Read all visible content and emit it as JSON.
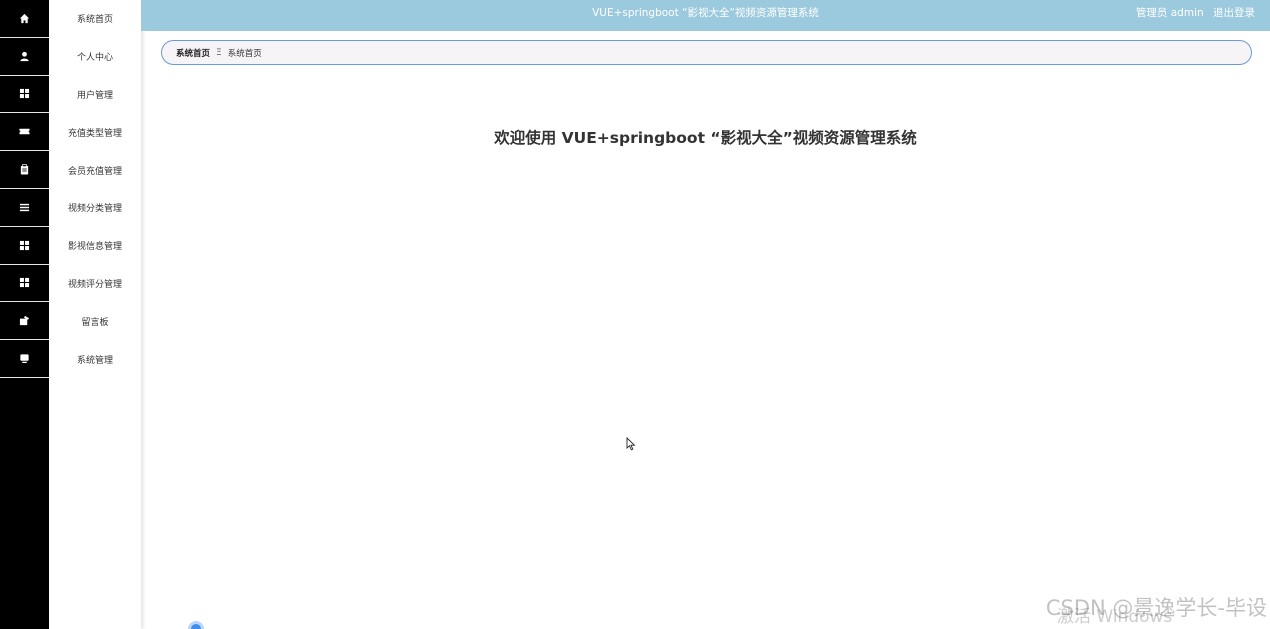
{
  "header": {
    "title": "VUE+springboot “影视大全”视频资源管理系统",
    "user_label": "管理员 admin",
    "logout": "退出登录"
  },
  "sidebar": {
    "items": [
      {
        "label": "系统首页",
        "icon": "home-icon"
      },
      {
        "label": "个人中心",
        "icon": "user-icon"
      },
      {
        "label": "用户管理",
        "icon": "grid-icon"
      },
      {
        "label": "充值类型管理",
        "icon": "ticket-icon"
      },
      {
        "label": "会员充值管理",
        "icon": "clipboard-icon"
      },
      {
        "label": "视频分类管理",
        "icon": "list-icon"
      },
      {
        "label": "影视信息管理",
        "icon": "grid-icon"
      },
      {
        "label": "视频评分管理",
        "icon": "grid-icon"
      },
      {
        "label": "留言板",
        "icon": "message-icon"
      },
      {
        "label": "系统管理",
        "icon": "monitor-icon"
      }
    ]
  },
  "breadcrumb": {
    "home": "系统首页",
    "separator": "Ξ",
    "current": "系统首页"
  },
  "main": {
    "welcome": "欢迎使用 VUE+springboot “影视大全”视频资源管理系统"
  },
  "watermark": {
    "text": "CSDN @景逸学长-毕设",
    "os_text": "激活 Windows"
  },
  "colors": {
    "header_bg": "#9bc9dd",
    "rail_bg": "#000000",
    "breadcrumb_border": "#6a9ad7"
  }
}
